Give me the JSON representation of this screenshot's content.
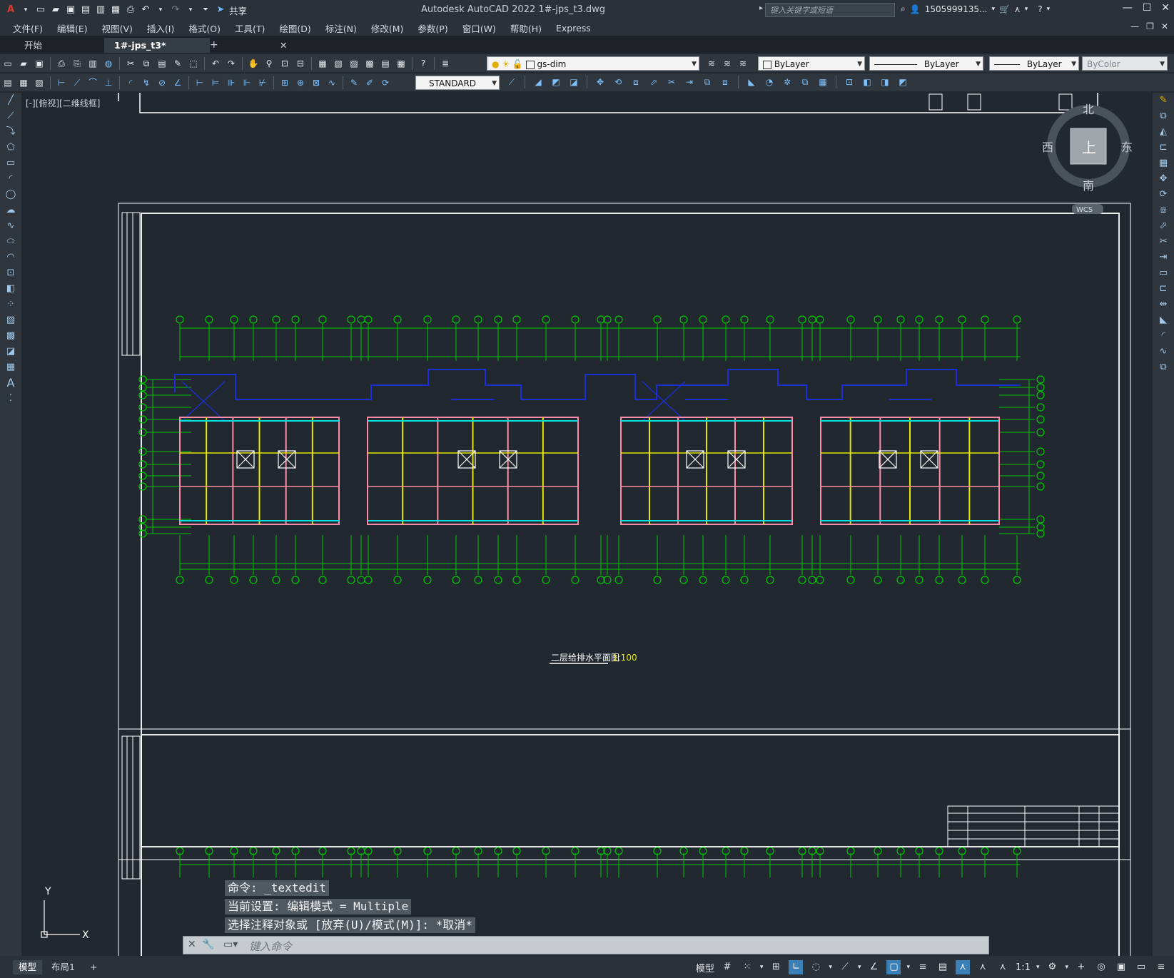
{
  "window": {
    "app_title": "Autodesk AutoCAD 2022    1#-jps_t3.dwg",
    "search_placeholder": "键入关键字或短语",
    "user_name": "1505999135...",
    "share_label": "共享"
  },
  "menu": {
    "items": [
      "文件(F)",
      "编辑(E)",
      "视图(V)",
      "插入(I)",
      "格式(O)",
      "工具(T)",
      "绘图(D)",
      "标注(N)",
      "修改(M)",
      "参数(P)",
      "窗口(W)",
      "帮助(H)",
      "Express"
    ]
  },
  "tabs": {
    "start": "开始",
    "document": "1#-jps_t3*",
    "add": "+"
  },
  "toolbar": {
    "layer_name": "gs-dim",
    "text_style": "STANDARD",
    "color": "ByLayer",
    "linetype": "ByLayer",
    "lineweight": "ByLayer",
    "plot_style": "ByColor"
  },
  "viewport": {
    "label": "[-][俯视][二维线框]"
  },
  "viewcube": {
    "north": "北",
    "south": "南",
    "east": "东",
    "west": "西",
    "top_face": "上",
    "wcs": "WCS"
  },
  "drawing": {
    "title": "二层给排水平面图",
    "scale": "1:100"
  },
  "ucs": {
    "x": "X",
    "y": "Y"
  },
  "command": {
    "line1": "命令: _textedit",
    "line2": "当前设置: 编辑模式 = Multiple",
    "line3": "选择注释对象或 [放弃(U)/模式(M)]: *取消*",
    "placeholder": "键入命令"
  },
  "layout_tabs": {
    "model": "模型",
    "layout1": "布局1",
    "add": "+"
  },
  "status": {
    "model_label": "模型",
    "scale": "1:1"
  },
  "colors": {
    "background": "#212830",
    "green_line": "#00c800",
    "pink_wall": "#ff8ca6",
    "yellow_wall": "#e6e600",
    "blue": "#1c2ed6",
    "cyan": "#00e0e0"
  }
}
